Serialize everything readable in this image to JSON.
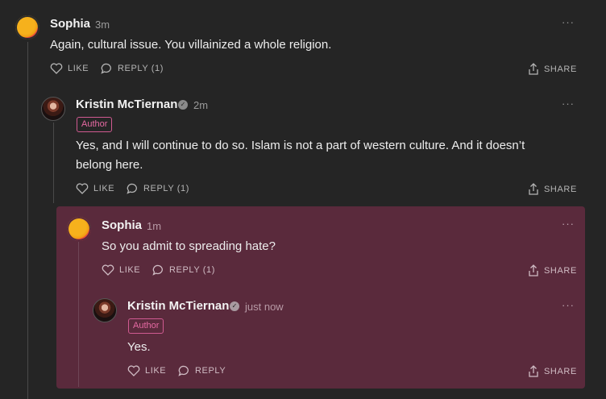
{
  "colors": {
    "background": "#252525",
    "highlight_panel": "#5a2a3c",
    "author_badge": "#e66aa3"
  },
  "comments": [
    {
      "author": "Sophia",
      "time": "3m",
      "text": "Again, cultural issue. You villainized a whole religion.",
      "like": "LIKE",
      "reply": "REPLY (1)",
      "share": "SHARE",
      "more": "···"
    },
    {
      "author": "Kristin McTiernan",
      "time": "2m",
      "badge": "Author",
      "text_line1": "Yes, and I will continue to do so. Islam is not a part of western culture. And it doesn’t",
      "text_line2": "belong here.",
      "like": "LIKE",
      "reply": "REPLY (1)",
      "share": "SHARE",
      "more": "···"
    },
    {
      "author": "Sophia",
      "time": "1m",
      "text": "So you admit to spreading hate?",
      "like": "LIKE",
      "reply": "REPLY (1)",
      "share": "SHARE",
      "more": "···"
    },
    {
      "author": "Kristin McTiernan",
      "time": "just now",
      "badge": "Author",
      "text": "Yes.",
      "like": "LIKE",
      "reply": "REPLY",
      "share": "SHARE",
      "more": "···"
    }
  ]
}
